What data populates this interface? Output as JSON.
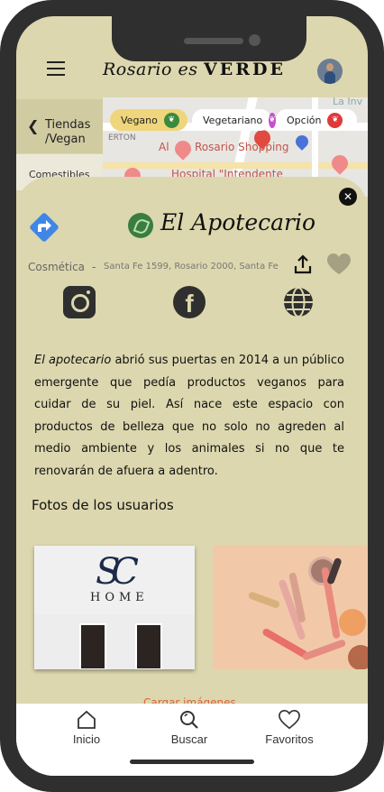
{
  "header": {
    "brand_script": "Rosario es",
    "brand_bold": "VERDE"
  },
  "sidebar": {
    "back_label": "Tiendas",
    "sub_label": "/Vegan",
    "category": "Comestibles"
  },
  "map": {
    "labels": [
      "Al",
      "Rosario Shopping",
      "Hospital \"Intendente",
      "La Inv",
      "ERTON"
    ]
  },
  "filters": [
    {
      "label": "Vegano",
      "color": "#3b8a3e"
    },
    {
      "label": "Vegetariano",
      "color": "#c64fd1"
    },
    {
      "label": "Opción",
      "color": "#e03a3a"
    }
  ],
  "shop": {
    "name": "El Apotecario",
    "category": "Cosmética",
    "separator": "-",
    "address": "Santa Fe 1599, Rosario 2000, Santa Fe",
    "description_em": "El apotecario",
    "description": " abrió sus puertas en 2014 a un público emergente que pedía productos veganos para cuidar de su piel. Así nace este espacio con productos de belleza que no solo no agreden al medio ambiente y los animales si no que te renovarán de afuera a adentro."
  },
  "photos": {
    "title": "Fotos de los usuarios",
    "photo1_mark": "SC",
    "photo1_text": "HOME",
    "load_more": "Cargar imágenes"
  },
  "tabbar": {
    "items": [
      {
        "label": "Inicio",
        "icon": "home-icon"
      },
      {
        "label": "Buscar",
        "icon": "search-icon"
      },
      {
        "label": "Favoritos",
        "icon": "heart-icon"
      }
    ]
  },
  "colors": {
    "background": "#dcd7ae",
    "accent": "#d9643a",
    "vegan_chip": "#efd57c"
  }
}
